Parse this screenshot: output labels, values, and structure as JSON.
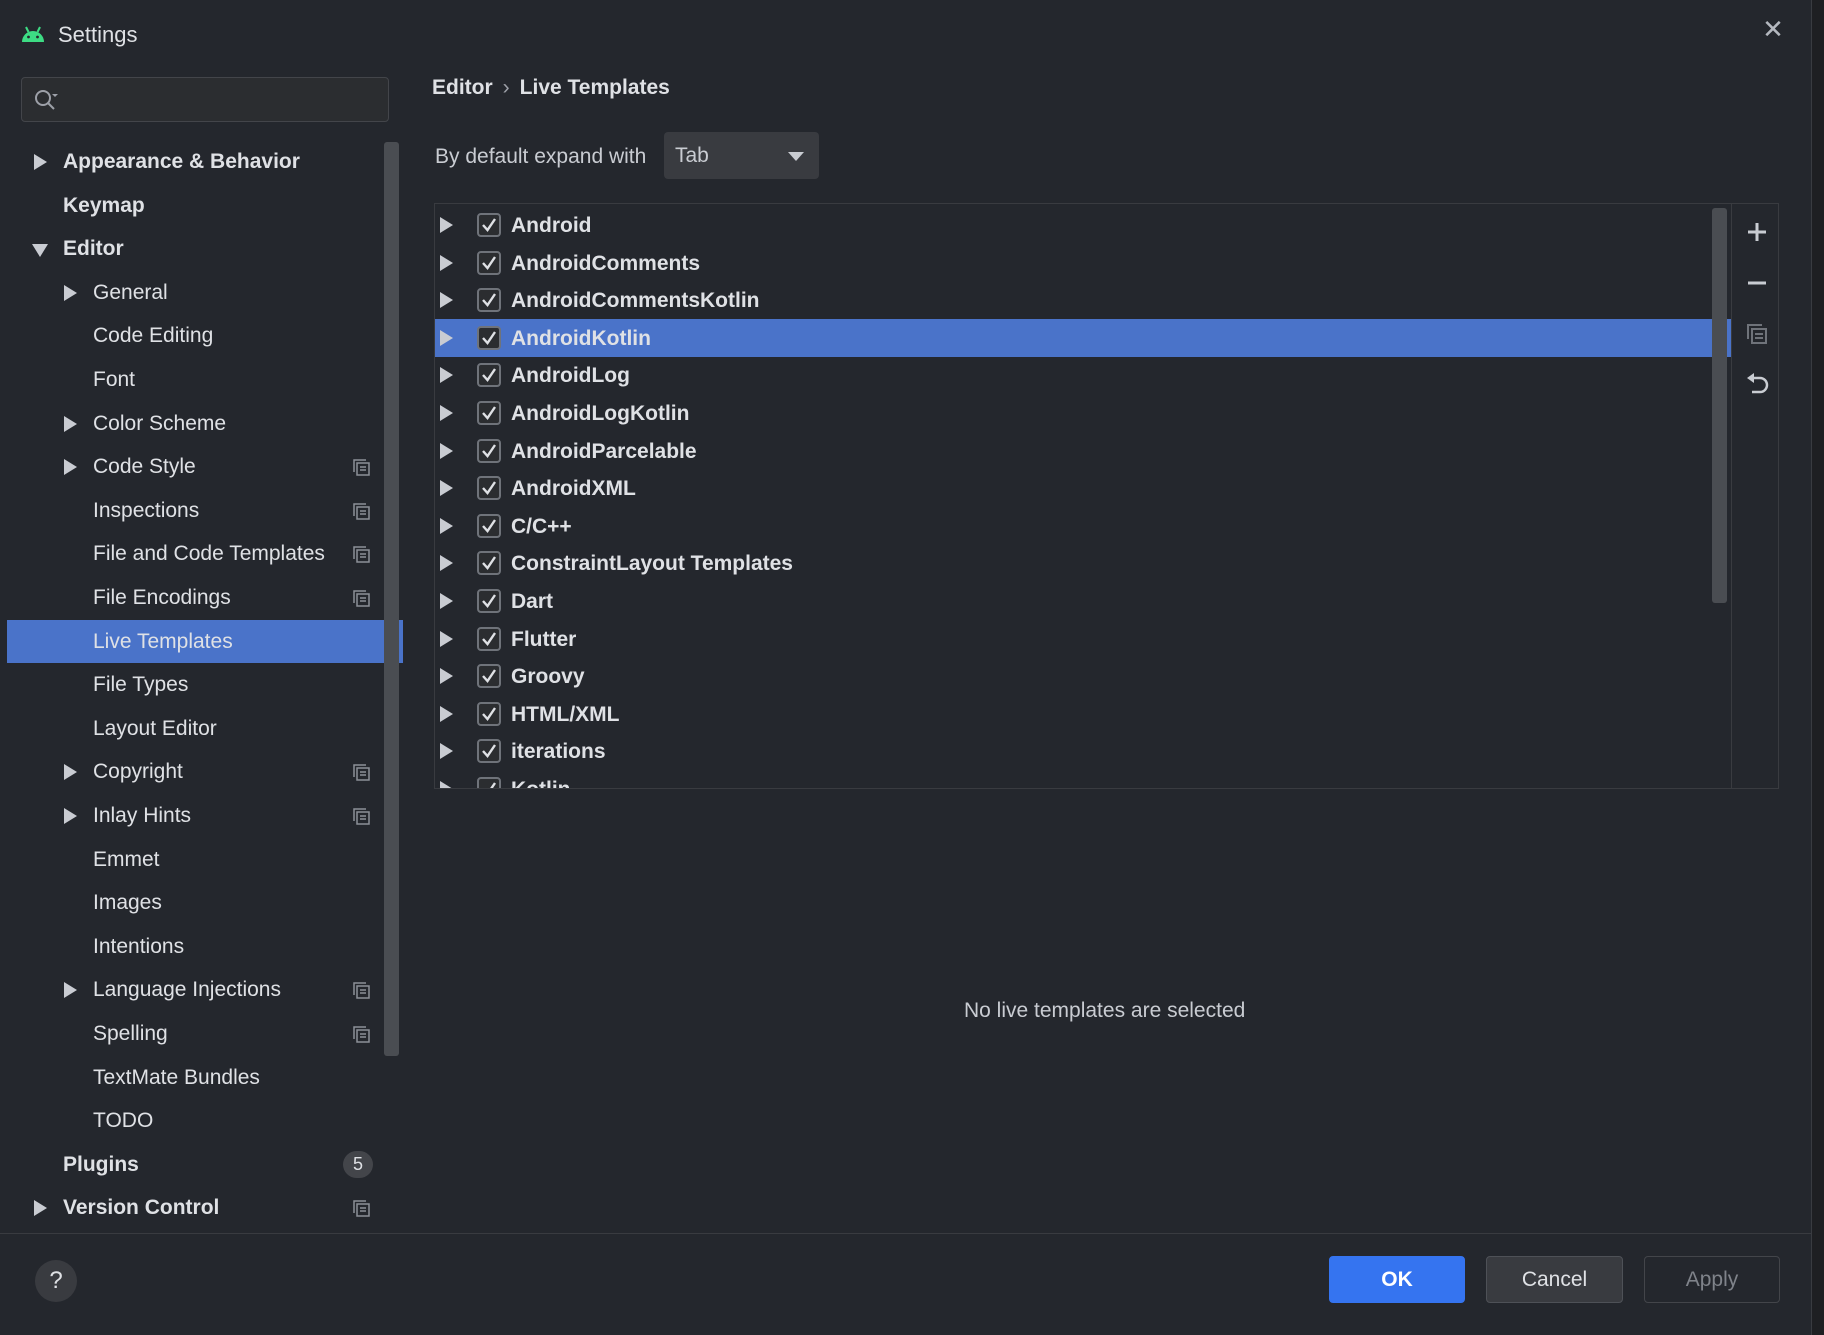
{
  "window": {
    "title": "Settings"
  },
  "search": {
    "placeholder": ""
  },
  "sidebar": {
    "items": [
      {
        "label": "Appearance & Behavior",
        "bold": true,
        "level": 0,
        "arrow": "right",
        "copy": false
      },
      {
        "label": "Keymap",
        "bold": true,
        "level": 0,
        "arrow": "none",
        "copy": false
      },
      {
        "label": "Editor",
        "bold": true,
        "level": 0,
        "arrow": "down",
        "copy": false
      },
      {
        "label": "General",
        "bold": false,
        "level": 1,
        "arrow": "right",
        "copy": false
      },
      {
        "label": "Code Editing",
        "bold": false,
        "level": 1,
        "arrow": "none",
        "copy": false
      },
      {
        "label": "Font",
        "bold": false,
        "level": 1,
        "arrow": "none",
        "copy": false
      },
      {
        "label": "Color Scheme",
        "bold": false,
        "level": 1,
        "arrow": "right",
        "copy": false
      },
      {
        "label": "Code Style",
        "bold": false,
        "level": 1,
        "arrow": "right",
        "copy": true
      },
      {
        "label": "Inspections",
        "bold": false,
        "level": 1,
        "arrow": "none",
        "copy": true
      },
      {
        "label": "File and Code Templates",
        "bold": false,
        "level": 1,
        "arrow": "none",
        "copy": true
      },
      {
        "label": "File Encodings",
        "bold": false,
        "level": 1,
        "arrow": "none",
        "copy": true
      },
      {
        "label": "Live Templates",
        "bold": false,
        "level": 1,
        "arrow": "none",
        "copy": false,
        "selected": true
      },
      {
        "label": "File Types",
        "bold": false,
        "level": 1,
        "arrow": "none",
        "copy": false
      },
      {
        "label": "Layout Editor",
        "bold": false,
        "level": 1,
        "arrow": "none",
        "copy": false
      },
      {
        "label": "Copyright",
        "bold": false,
        "level": 1,
        "arrow": "right",
        "copy": true
      },
      {
        "label": "Inlay Hints",
        "bold": false,
        "level": 1,
        "arrow": "right",
        "copy": true
      },
      {
        "label": "Emmet",
        "bold": false,
        "level": 1,
        "arrow": "none",
        "copy": false
      },
      {
        "label": "Images",
        "bold": false,
        "level": 1,
        "arrow": "none",
        "copy": false
      },
      {
        "label": "Intentions",
        "bold": false,
        "level": 1,
        "arrow": "none",
        "copy": false
      },
      {
        "label": "Language Injections",
        "bold": false,
        "level": 1,
        "arrow": "right",
        "copy": true
      },
      {
        "label": "Spelling",
        "bold": false,
        "level": 1,
        "arrow": "none",
        "copy": true
      },
      {
        "label": "TextMate Bundles",
        "bold": false,
        "level": 1,
        "arrow": "none",
        "copy": false
      },
      {
        "label": "TODO",
        "bold": false,
        "level": 1,
        "arrow": "none",
        "copy": false
      },
      {
        "label": "Plugins",
        "bold": true,
        "level": 0,
        "arrow": "none",
        "copy": false,
        "badge": "5"
      },
      {
        "label": "Version Control",
        "bold": true,
        "level": 0,
        "arrow": "right",
        "copy": true
      }
    ]
  },
  "breadcrumb": {
    "parent": "Editor",
    "separator": "›",
    "current": "Live Templates"
  },
  "expand": {
    "label": "By default expand with",
    "value": "Tab"
  },
  "templates": [
    {
      "name": "Android",
      "checked": true
    },
    {
      "name": "AndroidComments",
      "checked": true
    },
    {
      "name": "AndroidCommentsKotlin",
      "checked": true
    },
    {
      "name": "AndroidKotlin",
      "checked": true,
      "selected": true
    },
    {
      "name": "AndroidLog",
      "checked": true
    },
    {
      "name": "AndroidLogKotlin",
      "checked": true
    },
    {
      "name": "AndroidParcelable",
      "checked": true
    },
    {
      "name": "AndroidXML",
      "checked": true
    },
    {
      "name": "C/C++",
      "checked": true
    },
    {
      "name": "ConstraintLayout Templates",
      "checked": true
    },
    {
      "name": "Dart",
      "checked": true
    },
    {
      "name": "Flutter",
      "checked": true
    },
    {
      "name": "Groovy",
      "checked": true
    },
    {
      "name": "HTML/XML",
      "checked": true
    },
    {
      "name": "iterations",
      "checked": true
    },
    {
      "name": "Kotlin",
      "checked": true
    }
  ],
  "toolbar": {
    "icons": [
      "add-icon",
      "remove-icon",
      "duplicate-icon",
      "restore-defaults-icon"
    ]
  },
  "empty_message": "No live templates are selected",
  "footer": {
    "help_label": "?",
    "ok_label": "OK",
    "cancel_label": "Cancel",
    "apply_label": "Apply"
  },
  "colors": {
    "accent": "#3574f0",
    "selection": "#4a73c9",
    "background": "#24272d",
    "android_green": "#3ddc84"
  }
}
